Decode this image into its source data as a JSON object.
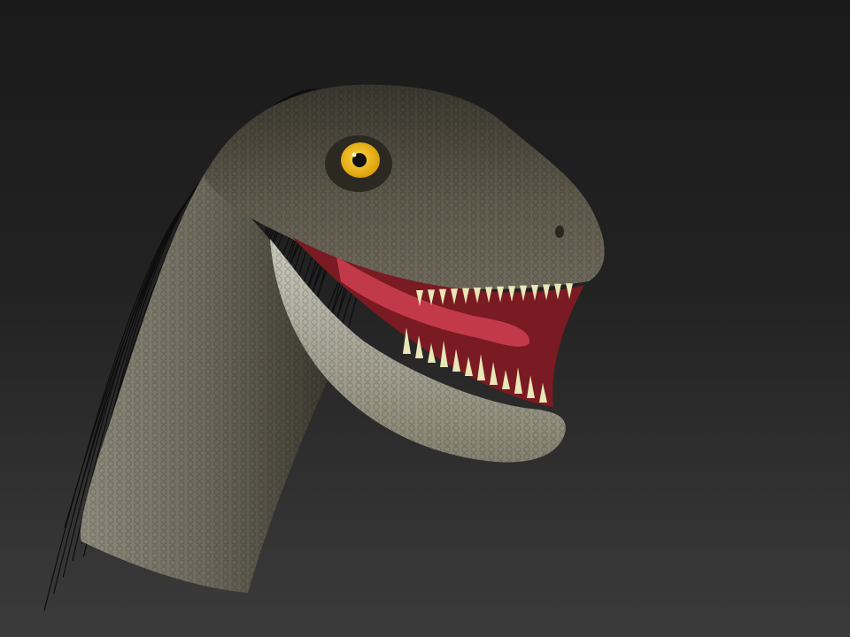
{
  "scene": {
    "subject": "dinosaur-head-render",
    "colors": {
      "background_top": "#1a1a1a",
      "background_bottom": "#3b3b3b",
      "skin_dark": "#3f3b31",
      "skin_mid": "#6f6a5c",
      "skin_light": "#a7a597",
      "jaw_light": "#bdbcb0",
      "mouth": "#7a1a22",
      "tongue": "#c23a4a",
      "gum": "#d45566",
      "teeth": "#e9e6b8",
      "eye_iris": "#f2b705",
      "eye_pupil": "#111111",
      "feathers": "#0d0d0d"
    }
  }
}
